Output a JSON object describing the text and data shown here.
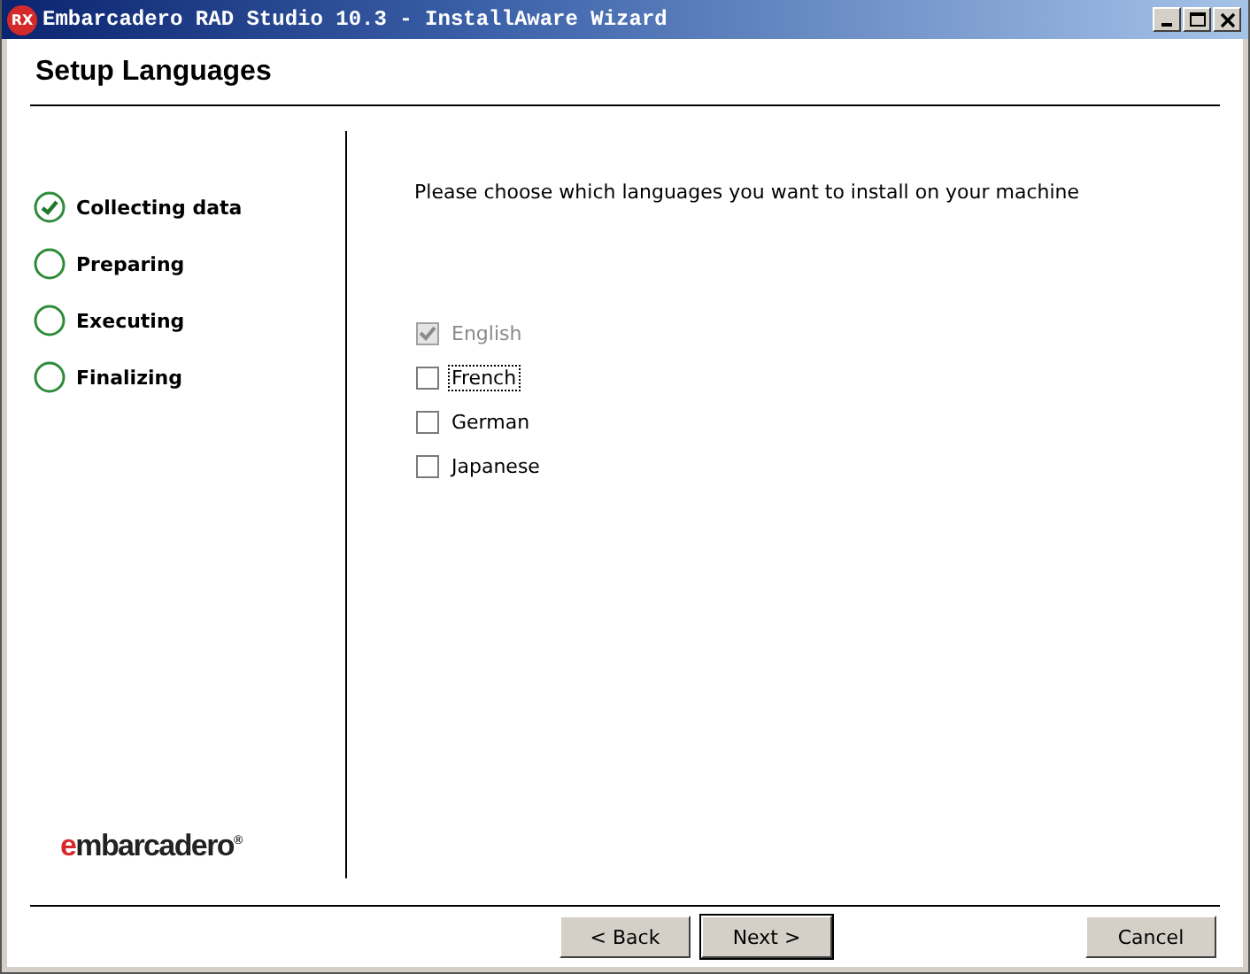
{
  "window": {
    "title": "Embarcadero RAD Studio 10.3 - InstallAware Wizard",
    "app_badge": "RX"
  },
  "header": {
    "title": "Setup Languages"
  },
  "steps": [
    {
      "label": "Collecting data",
      "done": true
    },
    {
      "label": "Preparing",
      "done": false
    },
    {
      "label": "Executing",
      "done": false
    },
    {
      "label": "Finalizing",
      "done": false
    }
  ],
  "logo": {
    "text": "embarcadero",
    "mark": "®"
  },
  "prompt": "Please choose which languages you want to install on your machine",
  "languages": [
    {
      "label": "English",
      "checked": true,
      "disabled": true,
      "focused": false
    },
    {
      "label": "French",
      "checked": false,
      "disabled": false,
      "focused": true
    },
    {
      "label": "German",
      "checked": false,
      "disabled": false,
      "focused": false
    },
    {
      "label": "Japanese",
      "checked": false,
      "disabled": false,
      "focused": false
    }
  ],
  "buttons": [
    {
      "label": "< Back",
      "default": false
    },
    {
      "label": "Next >",
      "default": true
    },
    {
      "label": "Cancel",
      "default": false
    }
  ]
}
